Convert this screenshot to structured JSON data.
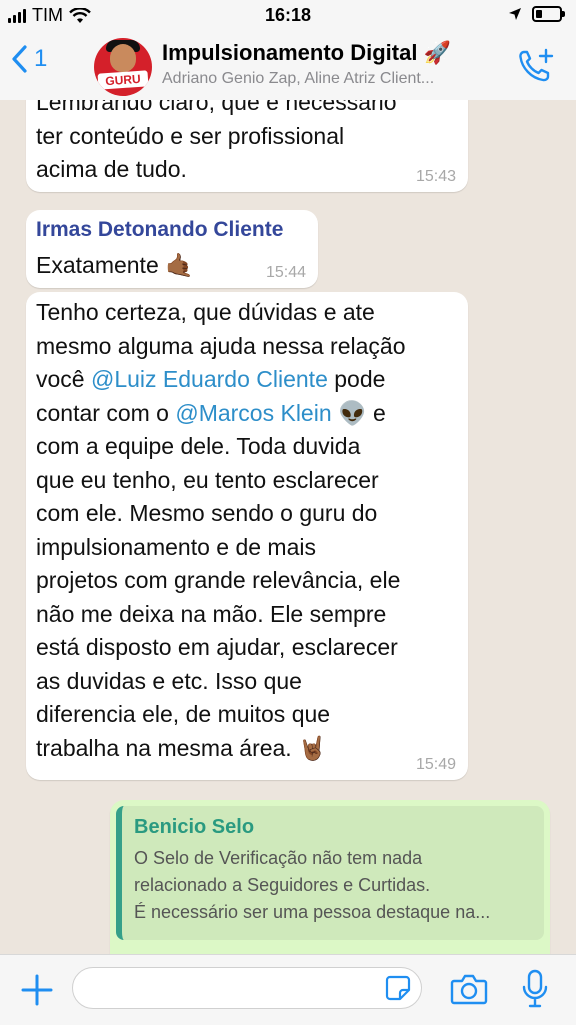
{
  "status_bar": {
    "carrier": "TIM",
    "time": "16:18"
  },
  "header": {
    "back_count": "1",
    "title": "Impulsionamento Digital 🚀",
    "subtitle": "Adriano Genio Zap, Aline Atriz Client...",
    "avatar_badge": "GURU"
  },
  "messages": [
    {
      "lines": [
        "Lembrando claro, que é necessário",
        "ter conteúdo e ser profissional",
        "acima de tudo."
      ],
      "time": "15:43"
    },
    {
      "sender": "Irmas Detonando Cliente",
      "text": "Exatamente 🤙🏾",
      "time": "15:44"
    },
    {
      "lines_pre": [
        "Tenho certeza, que dúvidas e ate",
        "mesmo alguma ajuda nessa relação"
      ],
      "line3_start": "você ",
      "mention1": "@Luiz Eduardo Cliente",
      "line3_end": " pode",
      "line4_start": "contar com o ",
      "mention2": "@Marcos Klein",
      "line4_end": " 👽 e",
      "lines_post": [
        "com a equipe dele. Toda duvida",
        "que eu tenho, eu tento esclarecer",
        "com ele. Mesmo sendo o guru do",
        "impulsionamento e de mais",
        "projetos com grande relevância, ele",
        "não me deixa na mão. Ele sempre",
        "está disposto em ajudar, esclarecer",
        "as duvidas e etc. Isso que",
        "diferencia ele, de muitos que",
        "trabalha na mesma área. 🤘🏾"
      ],
      "time": "15:49"
    }
  ],
  "reply": {
    "quoted_author": "Benicio Selo",
    "quoted_lines": [
      "O Selo de Verificação não tem nada",
      "relacionado a Seguidores e Curtidas.",
      "É necessário ser uma pessoa destaque na..."
    ]
  },
  "colors": {
    "accent": "#1f8ef1",
    "chat_bg": "#ece5dd",
    "outgoing": "#dcf8c6",
    "sender": "#34479a",
    "mention": "#2d8ec9"
  },
  "icons": [
    "back-chevron-icon",
    "add-call-icon",
    "plus-icon",
    "sticker-icon",
    "camera-icon",
    "mic-icon",
    "location-arrow-icon",
    "wifi-icon",
    "battery-icon",
    "signal-icon"
  ]
}
